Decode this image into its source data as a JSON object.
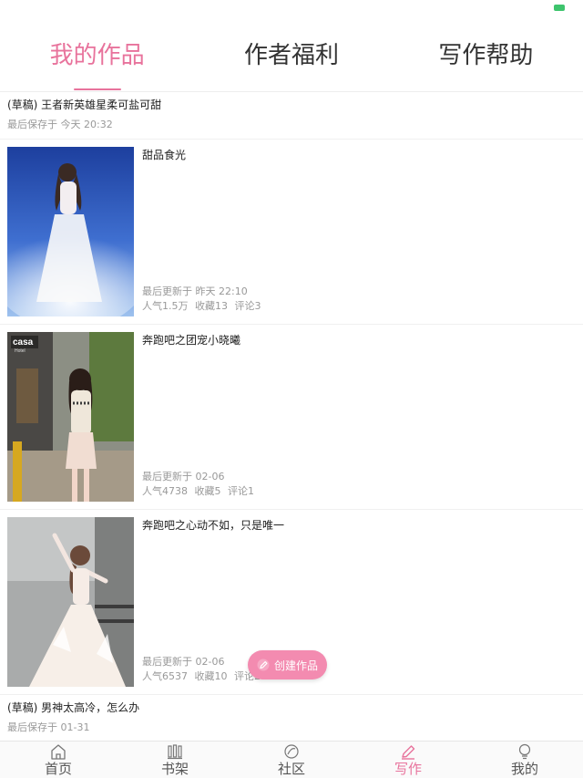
{
  "tabs": [
    {
      "label": "我的作品",
      "active": true
    },
    {
      "label": "作者福利",
      "active": false
    },
    {
      "label": "写作帮助",
      "active": false
    }
  ],
  "drafts": [
    {
      "title": "(草稿) 王者新英雄星柔可盐可甜",
      "meta": "最后保存于 今天 20:32"
    },
    {
      "title": "(草稿) 男神太高冷，怎么办",
      "meta": "最后保存于 01-31"
    }
  ],
  "works": [
    {
      "title": "甜品食光",
      "updated": "最后更新于 昨天 22:10",
      "popularity": "人气1.5万",
      "favorites": "收藏13",
      "comments": "评论3"
    },
    {
      "title": "奔跑吧之团宠小晓曦",
      "updated": "最后更新于 02-06",
      "popularity": "人气4738",
      "favorites": "收藏5",
      "comments": "评论1"
    },
    {
      "title": "奔跑吧之心动不如，只是唯一",
      "updated": "最后更新于 02-06",
      "popularity": "人气6537",
      "favorites": "收藏10",
      "comments": "评论2"
    }
  ],
  "cover_texts": {
    "casa": "casa",
    "casa_sub": "Hotel"
  },
  "fab": {
    "label": "创建作品",
    "icon": "pencil-icon"
  },
  "bottom_nav": [
    {
      "label": "首页",
      "icon": "home-icon",
      "active": false
    },
    {
      "label": "书架",
      "icon": "bookshelf-icon",
      "active": false
    },
    {
      "label": "社区",
      "icon": "community-icon",
      "active": false
    },
    {
      "label": "写作",
      "icon": "write-icon",
      "active": true
    },
    {
      "label": "我的",
      "icon": "profile-icon",
      "active": false
    }
  ],
  "colors": {
    "accent": "#e8739c",
    "fab": "#f38bb0",
    "meta_text": "#999999",
    "battery": "#3ec46d"
  }
}
